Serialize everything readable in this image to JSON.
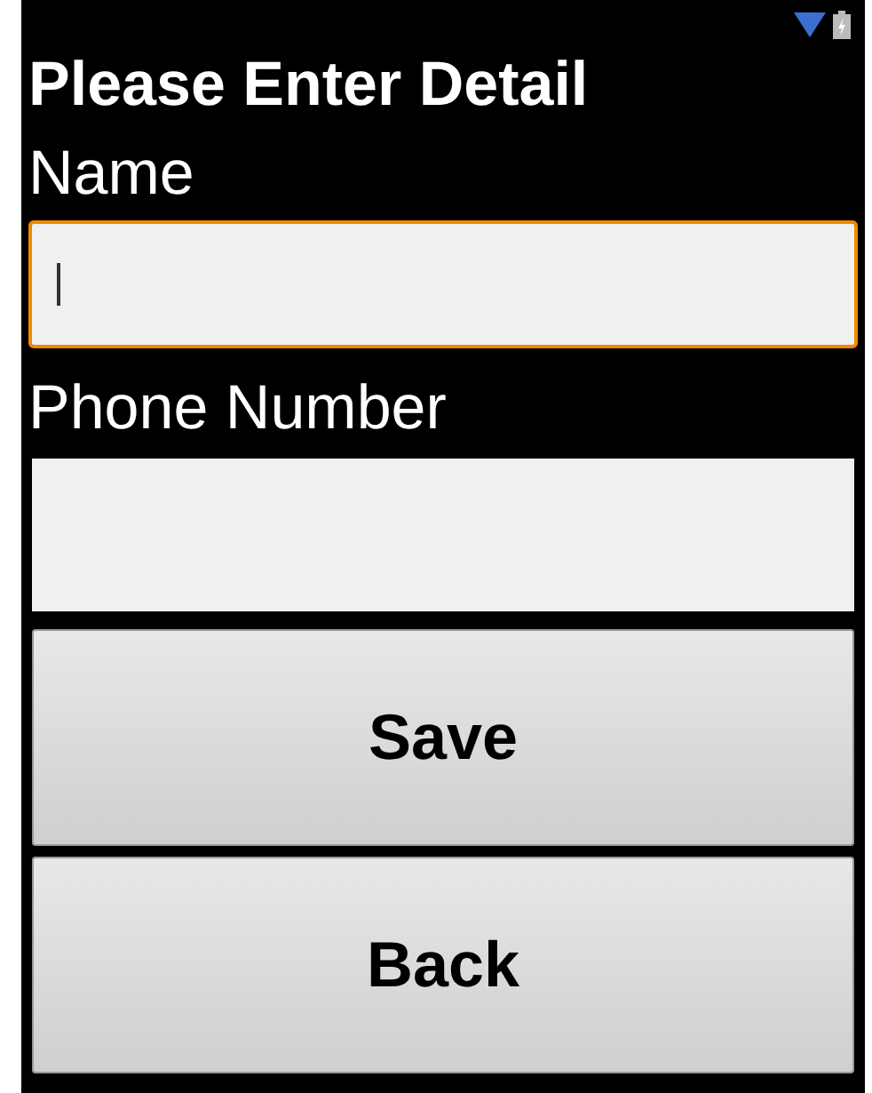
{
  "title": "Please Enter Detail",
  "fields": [
    {
      "label": "Name",
      "focused": true
    },
    {
      "label": "Phone Number",
      "focused": false
    }
  ],
  "buttons": [
    "Save",
    "Back"
  ]
}
